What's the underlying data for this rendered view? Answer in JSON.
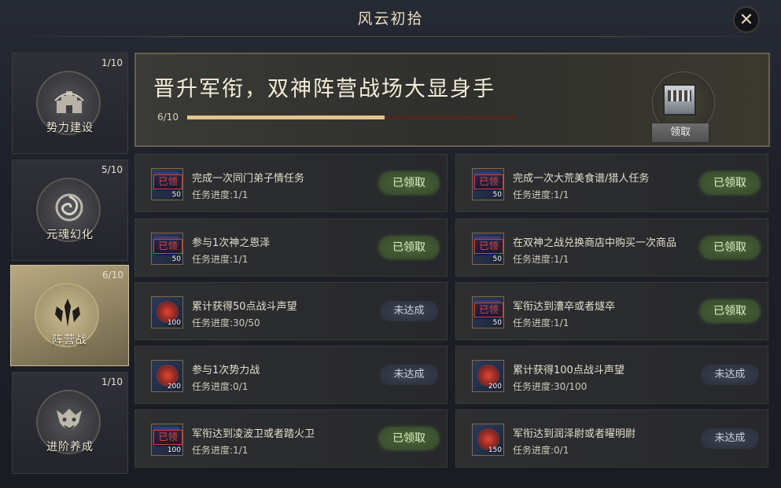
{
  "window": {
    "title": "风云初拾",
    "close_icon": "close-icon"
  },
  "sidebar": {
    "items": [
      {
        "label": "势力建设",
        "count": "1/10",
        "icon": "fortress-icon",
        "active": false
      },
      {
        "label": "元魂幻化",
        "count": "5/10",
        "icon": "spiral-icon",
        "active": false
      },
      {
        "label": "阵营战",
        "count": "6/10",
        "icon": "crest-icon",
        "active": true
      },
      {
        "label": "进阶养成",
        "count": "1/10",
        "icon": "beast-mask-icon",
        "active": false
      }
    ]
  },
  "banner": {
    "title": "晋升军衔，双神阵营战场大显身手",
    "progress_text": "6/10",
    "progress": 0.6,
    "reward_icon": "treasure-chest-icon",
    "claim_label": "领取"
  },
  "tasks": [
    {
      "name": "完成一次同门弟子情任务",
      "progress_label": "任务进度:",
      "progress": "1/1",
      "status": "已领取",
      "icon_stamp": "已领",
      "icon_num": "50"
    },
    {
      "name": "完成一次大荒美食谱/猎人任务",
      "progress_label": "任务进度:",
      "progress": "1/1",
      "status": "已领取",
      "icon_stamp": "已领",
      "icon_num": "50"
    },
    {
      "name": "参与1次神之恩泽",
      "progress_label": "任务进度:",
      "progress": "1/1",
      "status": "已领取",
      "icon_stamp": "已领",
      "icon_num": "50"
    },
    {
      "name": "在双神之战兑换商店中购买一次商品",
      "progress_label": "任务进度:",
      "progress": "1/1",
      "status": "已领取",
      "icon_stamp": "已领",
      "icon_num": "50"
    },
    {
      "name": "累计获得50点战斗声望",
      "progress_label": "任务进度:",
      "progress": "30/50",
      "status": "未达成",
      "icon_stamp": "",
      "icon_num": "100"
    },
    {
      "name": "军衔达到漕卒或者燧卒",
      "progress_label": "任务进度:",
      "progress": "1/1",
      "status": "已领取",
      "icon_stamp": "已领",
      "icon_num": "50"
    },
    {
      "name": "参与1次势力战",
      "progress_label": "任务进度:",
      "progress": "0/1",
      "status": "未达成",
      "icon_stamp": "",
      "icon_num": "200"
    },
    {
      "name": "累计获得100点战斗声望",
      "progress_label": "任务进度:",
      "progress": "30/100",
      "status": "未达成",
      "icon_stamp": "",
      "icon_num": "200"
    },
    {
      "name": "军衔达到凌波卫或者踏火卫",
      "progress_label": "任务进度:",
      "progress": "1/1",
      "status": "已领取",
      "icon_stamp": "已领",
      "icon_num": "100"
    },
    {
      "name": "军衔达到润泽尉或者曜明尉",
      "progress_label": "任务进度:",
      "progress": "0/1",
      "status": "未达成",
      "icon_stamp": "",
      "icon_num": "150"
    }
  ],
  "colors": {
    "done_button": "#4f6a3a",
    "pending_button": "#3e4556",
    "progress_fill": "#e2c68c",
    "active_tab": "#b9a981"
  }
}
